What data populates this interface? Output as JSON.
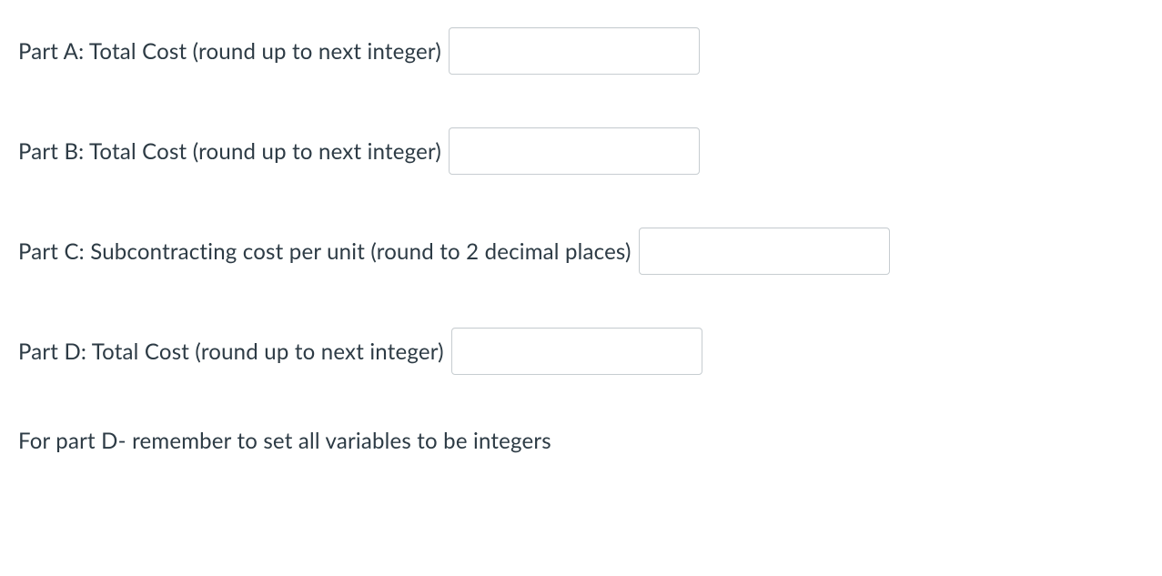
{
  "rows": {
    "partA": {
      "label": "Part A: Total Cost (round up to next integer)",
      "value": ""
    },
    "partB": {
      "label": "Part B: Total Cost (round up to next integer)",
      "value": ""
    },
    "partC": {
      "label": "Part C: Subcontracting cost per unit (round to 2 decimal places)",
      "value": ""
    },
    "partD": {
      "label": "Part D: Total Cost (round up to next integer)",
      "value": ""
    }
  },
  "note": "For part D- remember to set all variables to be integers"
}
